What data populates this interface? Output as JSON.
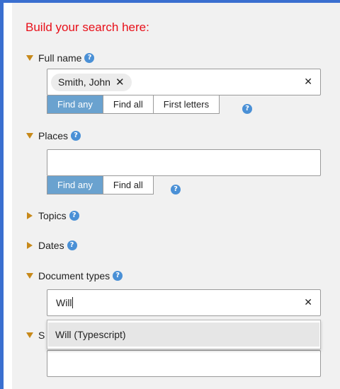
{
  "title": "Build your search here:",
  "sections": {
    "full_name": {
      "label": "Full name",
      "chip": "Smith, John",
      "match_options": [
        "Find any",
        "Find all",
        "First letters"
      ],
      "selected": "Find any"
    },
    "places": {
      "label": "Places",
      "value": "",
      "match_options": [
        "Find any",
        "Find all"
      ],
      "selected": "Find any"
    },
    "topics": {
      "label": "Topics"
    },
    "dates": {
      "label": "Dates"
    },
    "document_types": {
      "label": "Document types",
      "value": "Will",
      "suggestion": "Will (Typescript)"
    },
    "next_section": {
      "label_partial": "S",
      "value": ""
    }
  },
  "icons": {
    "help": "?",
    "clear": "✕",
    "chip_remove": "✕"
  },
  "colors": {
    "frame": "#3a6fd0",
    "title": "#e8101a",
    "caret": "#c7891a",
    "help": "#4a90d6",
    "active_segment": "#6aa2cf"
  }
}
